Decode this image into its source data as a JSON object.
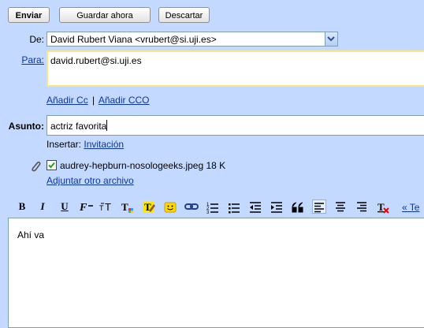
{
  "toolbar": {
    "send_label": "Enviar",
    "save_label": "Guardar ahora",
    "discard_label": "Descartar"
  },
  "from": {
    "label": "De:",
    "value": "David Rubert Viana <vrubert@si.uji.es>"
  },
  "to": {
    "label": "Para:",
    "value": "david.rubert@si.uji.es"
  },
  "cc_links": {
    "add_cc": "Añadir Cc",
    "separator": "|",
    "add_bcc": "Añadir CCO"
  },
  "subject": {
    "label": "Asunto:",
    "value": "actriz favorita"
  },
  "insert": {
    "label": "Insertar:",
    "invitation": "Invitación"
  },
  "attachment": {
    "filename": "audrey-hepburn-nosologeeks.jpeg",
    "size": "18 K",
    "checked": true,
    "attach_another": "Adjuntar otro archivo"
  },
  "format_toolbar": {
    "bold": "B",
    "italic": "I",
    "underline": "U",
    "text_link": "« Te"
  },
  "body": {
    "text": "Ahí va"
  },
  "colors": {
    "background": "#c3d9ff",
    "link": "#0b37a6",
    "to_field_border": "#ffe484"
  }
}
